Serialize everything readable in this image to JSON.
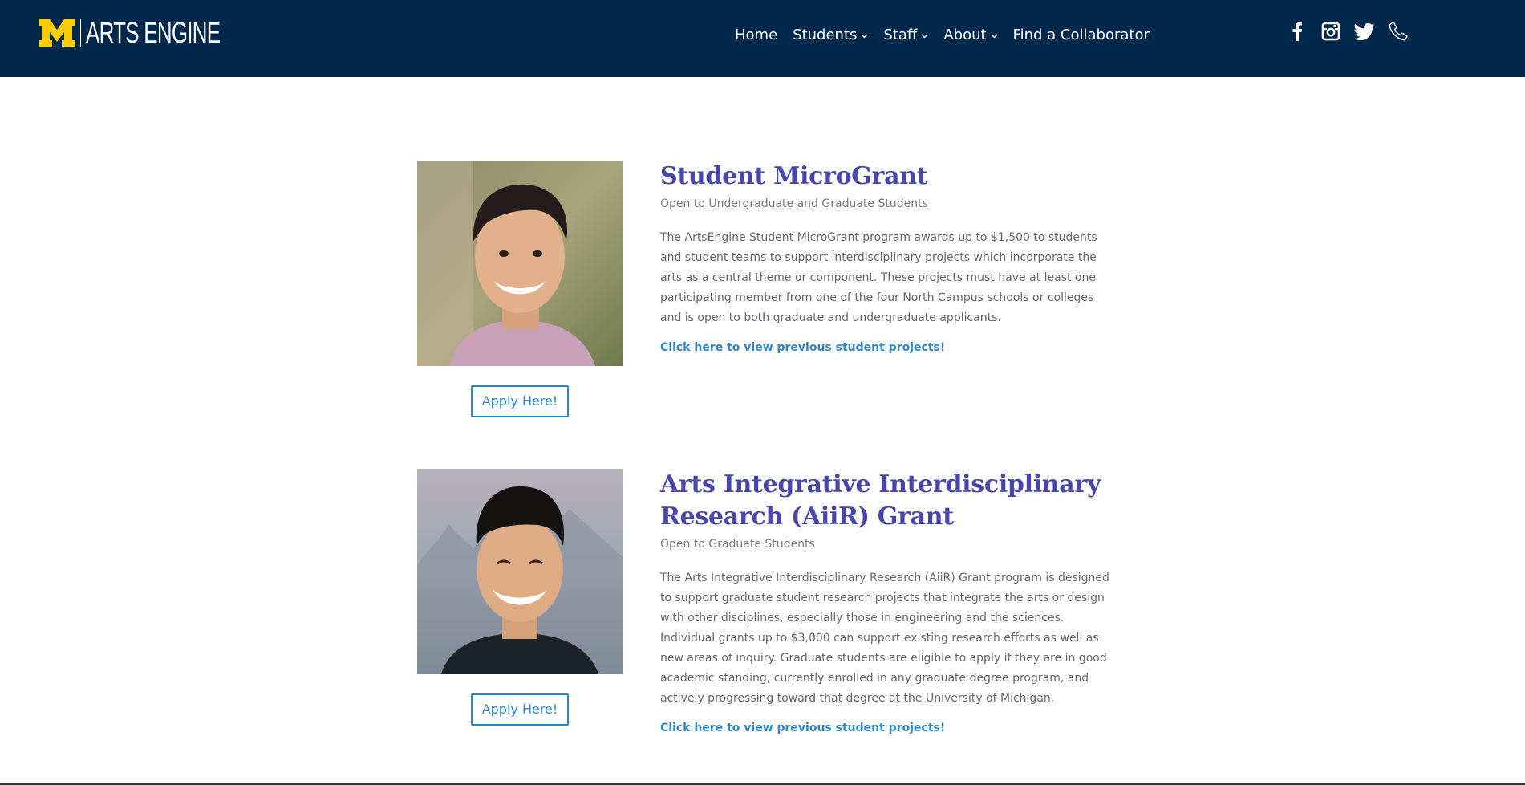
{
  "header": {
    "logo_text": "ARTS ENGINE",
    "brand_color": "#00274c",
    "maize": "#ffcb05"
  },
  "nav": {
    "items": [
      {
        "label": "Home",
        "has_dropdown": false
      },
      {
        "label": "Students",
        "has_dropdown": true
      },
      {
        "label": "Staff",
        "has_dropdown": true
      },
      {
        "label": "About",
        "has_dropdown": true
      },
      {
        "label": "Find a Collaborator",
        "has_dropdown": false
      }
    ]
  },
  "social": [
    "facebook-icon",
    "instagram-icon",
    "twitter-icon",
    "phone-icon"
  ],
  "grants": [
    {
      "title": "Student MicroGrant",
      "eligibility": "Open to Undergraduate and Graduate Students",
      "description": "The ArtsEngine Student MicroGrant program awards up to $1,500 to students and student teams to support interdisciplinary projects which incorporate the arts as a central theme or component. These projects must have at least one participating member from one of the four North Campus schools or colleges and is open to both graduate and undergraduate applicants.",
      "link": "Click here to view previous student projects!",
      "button": "Apply Here!"
    },
    {
      "title": "Arts Integrative Interdisciplinary Research (AiiR) Grant",
      "eligibility": "Open to Graduate Students",
      "description": "The Arts Integrative Interdisciplinary Research (AiiR) Grant program is designed to support graduate student research projects that integrate the arts or design with other disciplines, especially those in engineering and the sciences. Individual grants up to $3,000 can support existing research efforts as well as new areas of inquiry. Graduate students are eligible to apply if they are in good academic standing, currently enrolled in any graduate degree program, and actively progressing toward that degree at the University of Michigan.",
      "link": "Click here to view previous student projects!",
      "button": "Apply Here!"
    }
  ],
  "colors": {
    "title": "#4646ad",
    "link": "#2e86c9",
    "text": "#666666"
  }
}
